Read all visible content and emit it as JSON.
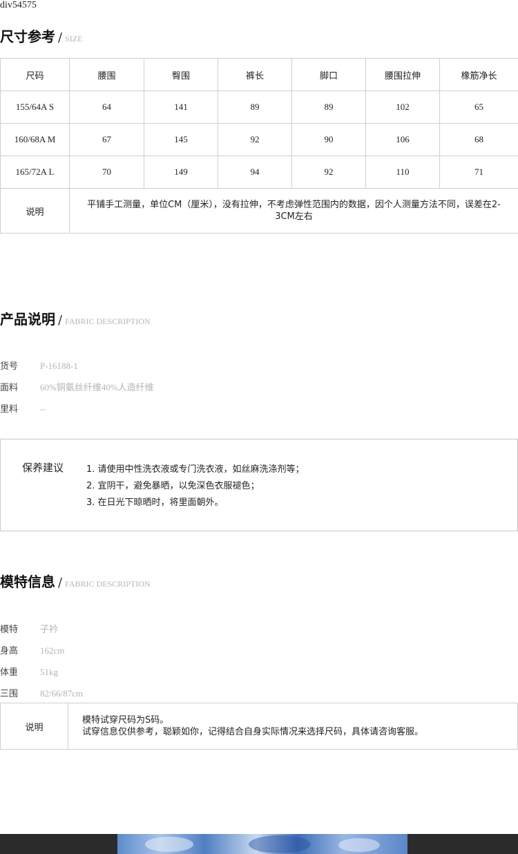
{
  "div_label": "div54575",
  "size_section": {
    "title": "尺寸参考",
    "slash": "/",
    "subtitle": "SIZE",
    "headers": [
      "尺码",
      "腰围",
      "臀围",
      "裤长",
      "脚口",
      "腰围拉伸",
      "橡筋净长"
    ],
    "rows": [
      [
        "155/64A S",
        "64",
        "141",
        "89",
        "89",
        "102",
        "65"
      ],
      [
        "160/68A M",
        "67",
        "145",
        "92",
        "90",
        "106",
        "68"
      ],
      [
        "165/72A L",
        "70",
        "149",
        "94",
        "92",
        "110",
        "71"
      ]
    ],
    "note_label": "说明",
    "note_text": "平铺手工测量，单位CM（厘米），没有拉伸，不考虑弹性范围内的数据，因个人测量方法不同，误差在2-3CM左右"
  },
  "product_section": {
    "title": "产品说明",
    "slash": "/",
    "subtitle": "FABRIC DESCRIPTION",
    "items": [
      {
        "label": "货号",
        "value": "P-16188-1"
      },
      {
        "label": "面料",
        "value": "60%铜氨丝纤维40%人造纤维"
      },
      {
        "label": "里料",
        "value": "--"
      }
    ]
  },
  "care": {
    "title": "保养建议",
    "items": [
      "1. 请使用中性洗衣液或专门洗衣液，如丝麻洗涤剂等；",
      "2. 宜阴干，避免暴晒，以免深色衣服褪色；",
      "3. 在日光下晾晒时，将里面朝外。"
    ]
  },
  "model_section": {
    "title": "模特信息",
    "slash": "/",
    "subtitle": "FABRIC DESCRIPTION",
    "items": [
      {
        "label": "模特",
        "value": "子衿"
      },
      {
        "label": "身高",
        "value": "162cm"
      },
      {
        "label": "体重",
        "value": "51kg"
      },
      {
        "label": "三围",
        "value": "82/66/87cm"
      }
    ],
    "note_label": "说明",
    "note_lines": [
      "模特试穿尺码为S码。",
      "试穿信息仅供参考，聪颖如你，记得结合自身实际情况来选择尺码，具体请咨询客服。"
    ]
  }
}
